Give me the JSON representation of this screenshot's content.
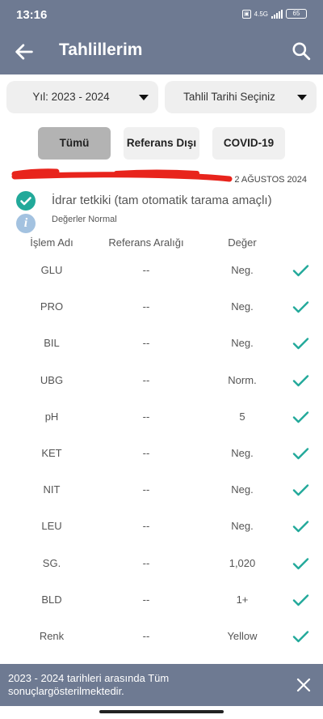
{
  "status_bar": {
    "time": "13:16",
    "network": "4.5G",
    "battery": "65"
  },
  "app_bar": {
    "title": "Tahlillerim",
    "back_icon": "arrow-left-icon",
    "search_icon": "search-icon"
  },
  "filters": {
    "year_dropdown": "Yıl: 2023 - 2024",
    "date_dropdown": "Tahlil Tarihi Seçiniz",
    "tabs": [
      {
        "label": "Tümü",
        "active": true
      },
      {
        "label": "Referans Dışı",
        "active": false
      },
      {
        "label": "COVID-19",
        "active": false
      }
    ]
  },
  "result": {
    "date": "2 AĞUSTOS 2024",
    "test_name": "İdrar tetkiki (tam otomatik tarama amaçlı)",
    "status_text": "Değerler Normal",
    "info_icon_label": "i"
  },
  "table": {
    "headers": {
      "name": "İşlem Adı",
      "range": "Referans Aralığı",
      "value": "Değer"
    },
    "rows": [
      {
        "name": "GLU",
        "range": "--",
        "value": "Neg."
      },
      {
        "name": "PRO",
        "range": "--",
        "value": "Neg."
      },
      {
        "name": "BIL",
        "range": "--",
        "value": "Neg."
      },
      {
        "name": "UBG",
        "range": "--",
        "value": "Norm."
      },
      {
        "name": "pH",
        "range": "--",
        "value": "5"
      },
      {
        "name": "KET",
        "range": "--",
        "value": "Neg."
      },
      {
        "name": "NIT",
        "range": "--",
        "value": "Neg."
      },
      {
        "name": "LEU",
        "range": "--",
        "value": "Neg."
      },
      {
        "name": "SG.",
        "range": "--",
        "value": "1,020"
      },
      {
        "name": "BLD",
        "range": "--",
        "value": "1+"
      },
      {
        "name": "Renk",
        "range": "--",
        "value": "Yellow"
      }
    ]
  },
  "snackbar": {
    "message": "2023 - 2024 tarihleri arasında Tüm sonuçlargösterilmektedir."
  },
  "colors": {
    "header": "#6e7a92",
    "accent": "#22a99a",
    "info": "#a3c2e0",
    "redaction": "#e8241c"
  }
}
